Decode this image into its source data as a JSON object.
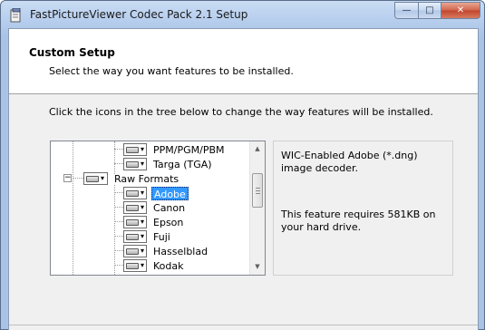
{
  "window": {
    "title": "FastPictureViewer Codec Pack 2.1 Setup",
    "minimize_glyph": "—",
    "maximize_glyph": "□",
    "close_glyph": "✕"
  },
  "banner": {
    "title": "Custom Setup",
    "subtitle": "Select the way you want features to be installed."
  },
  "instructions": "Click the icons in the tree below to change the way features will be installed.",
  "tree": {
    "items": [
      {
        "label": "PPM/PGM/PBM",
        "selected": false
      },
      {
        "label": "Targa (TGA)",
        "selected": false
      },
      {
        "label": "Raw Formats",
        "selected": false,
        "expander": "−"
      },
      {
        "label": "Adobe",
        "selected": true
      },
      {
        "label": "Canon",
        "selected": false
      },
      {
        "label": "Epson",
        "selected": false
      },
      {
        "label": "Fuji",
        "selected": false
      },
      {
        "label": "Hasselblad",
        "selected": false
      },
      {
        "label": "Kodak",
        "selected": false
      }
    ],
    "dropdown_glyph": "▾",
    "scroll_up_glyph": "▲",
    "scroll_down_glyph": "▼"
  },
  "description": {
    "text": "WIC-Enabled Adobe (*.dng) image decoder.",
    "size_text": "This feature requires 581KB on your hard drive."
  },
  "colors": {
    "selection": "#3399ff",
    "close_button": "#c0452d",
    "frame": "#a9c3e6"
  }
}
